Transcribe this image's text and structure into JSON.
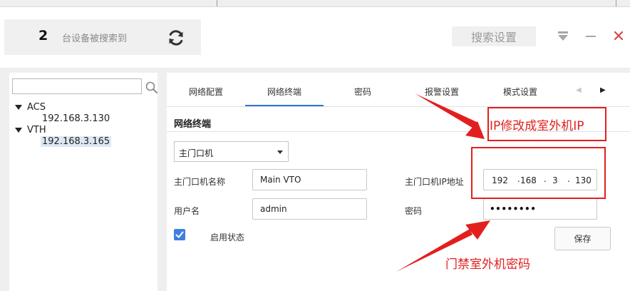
{
  "header": {
    "device_count": "2",
    "devices_found_text": "台设备被搜索到",
    "search_settings_label": "搜索设置"
  },
  "device_tree": {
    "search_value": "",
    "groups": [
      {
        "name": "ACS",
        "devices": [
          "192.168.3.130"
        ]
      },
      {
        "name": "VTH",
        "devices": [
          "192.168.3.165"
        ]
      }
    ],
    "selected_device": "192.168.3.165"
  },
  "tabs": [
    {
      "label": "网络配置"
    },
    {
      "label": "网络终端",
      "active": true
    },
    {
      "label": "密码"
    },
    {
      "label": "报警设置"
    },
    {
      "label": "模式设置"
    }
  ],
  "form": {
    "section_title": "网络终端",
    "device_type_value": "主门口机",
    "name_label": "主门口机名称",
    "name_value": "Main VTO",
    "ip_label": "主门口机IP地址",
    "ip_octets": [
      "192",
      "168",
      "3",
      "130"
    ],
    "username_label": "用户名",
    "username_value": "admin",
    "password_label": "密码",
    "password_display": "••••••••",
    "enable_label": "启用状态",
    "enabled": true,
    "save_label": "保存"
  },
  "annotations": {
    "ip_note": "IP修改成室外机IP",
    "password_note": "门禁室外机密码",
    "color": "#e21f1f"
  },
  "colors": {
    "accent": "#2f77d6",
    "checkbox": "#3f7fe0",
    "annotation_red": "#e21f1f"
  }
}
